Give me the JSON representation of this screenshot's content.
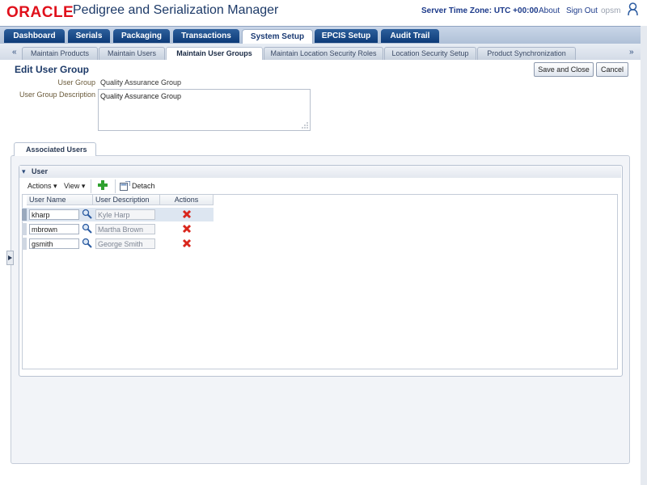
{
  "header": {
    "logo": "ORACLE",
    "app_title": "Pedigree and Serialization Manager",
    "server_time_zone": "Server Time Zone: UTC +00:00",
    "about": "About",
    "sign_out": "Sign Out",
    "user": "opsm"
  },
  "top_tabs": [
    "Dashboard",
    "Serials",
    "Packaging",
    "Transactions",
    "System Setup",
    "EPCIS Setup",
    "Audit Trail"
  ],
  "top_tab_selected": "System Setup",
  "sub_tabs": [
    "Maintain Products",
    "Maintain Users",
    "Maintain User Groups",
    "Maintain Location Security Roles",
    "Location Security Setup",
    "Product Synchronization"
  ],
  "sub_tab_selected": "Maintain User Groups",
  "page": {
    "title": "Edit User Group",
    "save_and_close": "Save and Close",
    "cancel": "Cancel",
    "user_group_label": "User Group",
    "user_group_value": "Quality Assurance Group",
    "description_label": "User Group Description",
    "description_value": "Quality Assurance Group"
  },
  "associated_users": {
    "tab_label": "Associated Users",
    "section_title": "User",
    "toolbar": {
      "actions": "Actions",
      "view": "View",
      "detach": "Detach"
    },
    "columns": [
      "User Name",
      "User Description",
      "Actions"
    ],
    "rows": [
      {
        "user_name": "kharp",
        "description": "Kyle Harp"
      },
      {
        "user_name": "mbrown",
        "description": "Martha Brown"
      },
      {
        "user_name": "gsmith",
        "description": "George Smith"
      }
    ]
  },
  "colors": {
    "oracle_red": "#e0101b",
    "tab_blue": "#0d3b78",
    "delete_red": "#d9261c",
    "add_green": "#2fa12f"
  }
}
